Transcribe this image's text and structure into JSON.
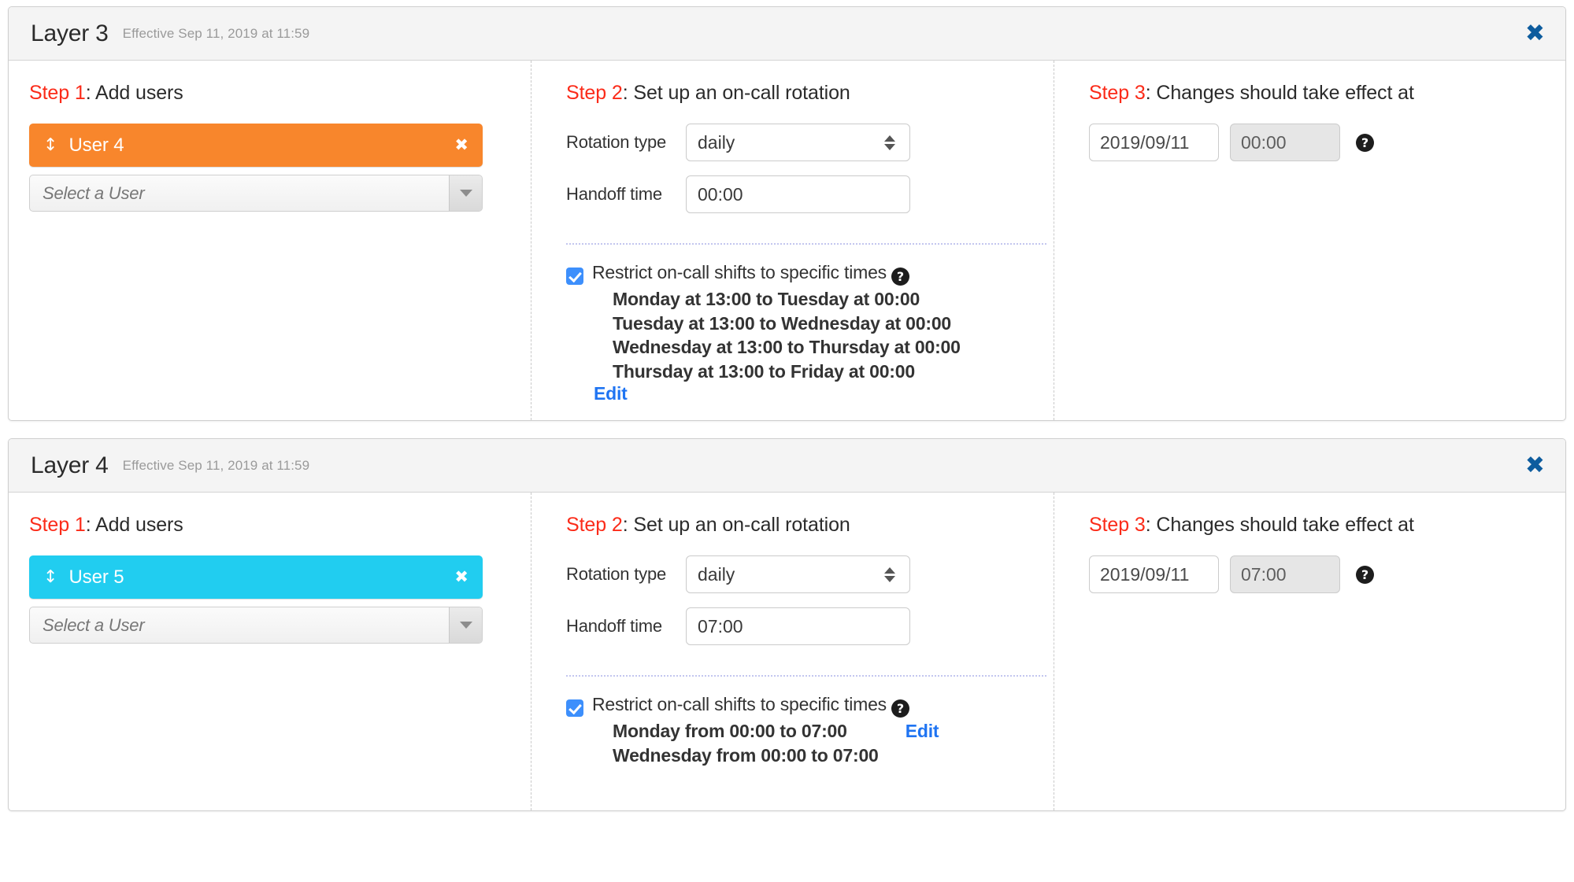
{
  "layers": [
    {
      "title": "Layer 3",
      "effective": "Effective Sep 11, 2019 at 11:59",
      "close_label": "✖",
      "step1": {
        "heading_label": "Step 1",
        "heading_rest": ": Add users",
        "users": [
          {
            "name": "User 4",
            "color": "#f8862c",
            "remove_label": "✖",
            "drag_label": "↕"
          }
        ],
        "select_placeholder": "Select a User"
      },
      "step2": {
        "heading_label": "Step 2",
        "heading_rest": ": Set up an on-call rotation",
        "rotation_type_label": "Rotation type",
        "rotation_type_value": "daily",
        "handoff_label": "Handoff time",
        "handoff_value": "00:00",
        "restrict_label": "Restrict on-call shifts to specific times",
        "help_glyph": "?",
        "shifts": [
          "Monday at 13:00 to Tuesday at 00:00",
          "Tuesday at 13:00 to Wednesday at 00:00",
          "Wednesday at 13:00 to Thursday at 00:00",
          "Thursday at 13:00 to Friday at 00:00"
        ],
        "edit_label": "Edit",
        "edit_position": "below"
      },
      "step3": {
        "heading_label": "Step 3",
        "heading_rest": ": Changes should take effect at",
        "date_value": "2019/09/11",
        "time_value": "00:00",
        "help_glyph": "?"
      }
    },
    {
      "title": "Layer 4",
      "effective": "Effective Sep 11, 2019 at 11:59",
      "close_label": "✖",
      "step1": {
        "heading_label": "Step 1",
        "heading_rest": ": Add users",
        "users": [
          {
            "name": "User 5",
            "color": "#21cdf0",
            "remove_label": "✖",
            "drag_label": "↕"
          }
        ],
        "select_placeholder": "Select a User"
      },
      "step2": {
        "heading_label": "Step 2",
        "heading_rest": ": Set up an on-call rotation",
        "rotation_type_label": "Rotation type",
        "rotation_type_value": "daily",
        "handoff_label": "Handoff time",
        "handoff_value": "07:00",
        "restrict_label": "Restrict on-call shifts to specific times",
        "help_glyph": "?",
        "shifts": [
          "Monday from 00:00 to 07:00",
          "Wednesday from 00:00 to 07:00"
        ],
        "edit_label": "Edit",
        "edit_position": "inline"
      },
      "step3": {
        "heading_label": "Step 3",
        "heading_rest": ": Changes should take effect at",
        "date_value": "2019/09/11",
        "time_value": "07:00",
        "help_glyph": "?"
      }
    }
  ],
  "colors": {
    "step_accent": "#fb2b19",
    "link": "#1f74f2",
    "checkbox": "#3d8ffc",
    "close": "#0d5c9e"
  }
}
